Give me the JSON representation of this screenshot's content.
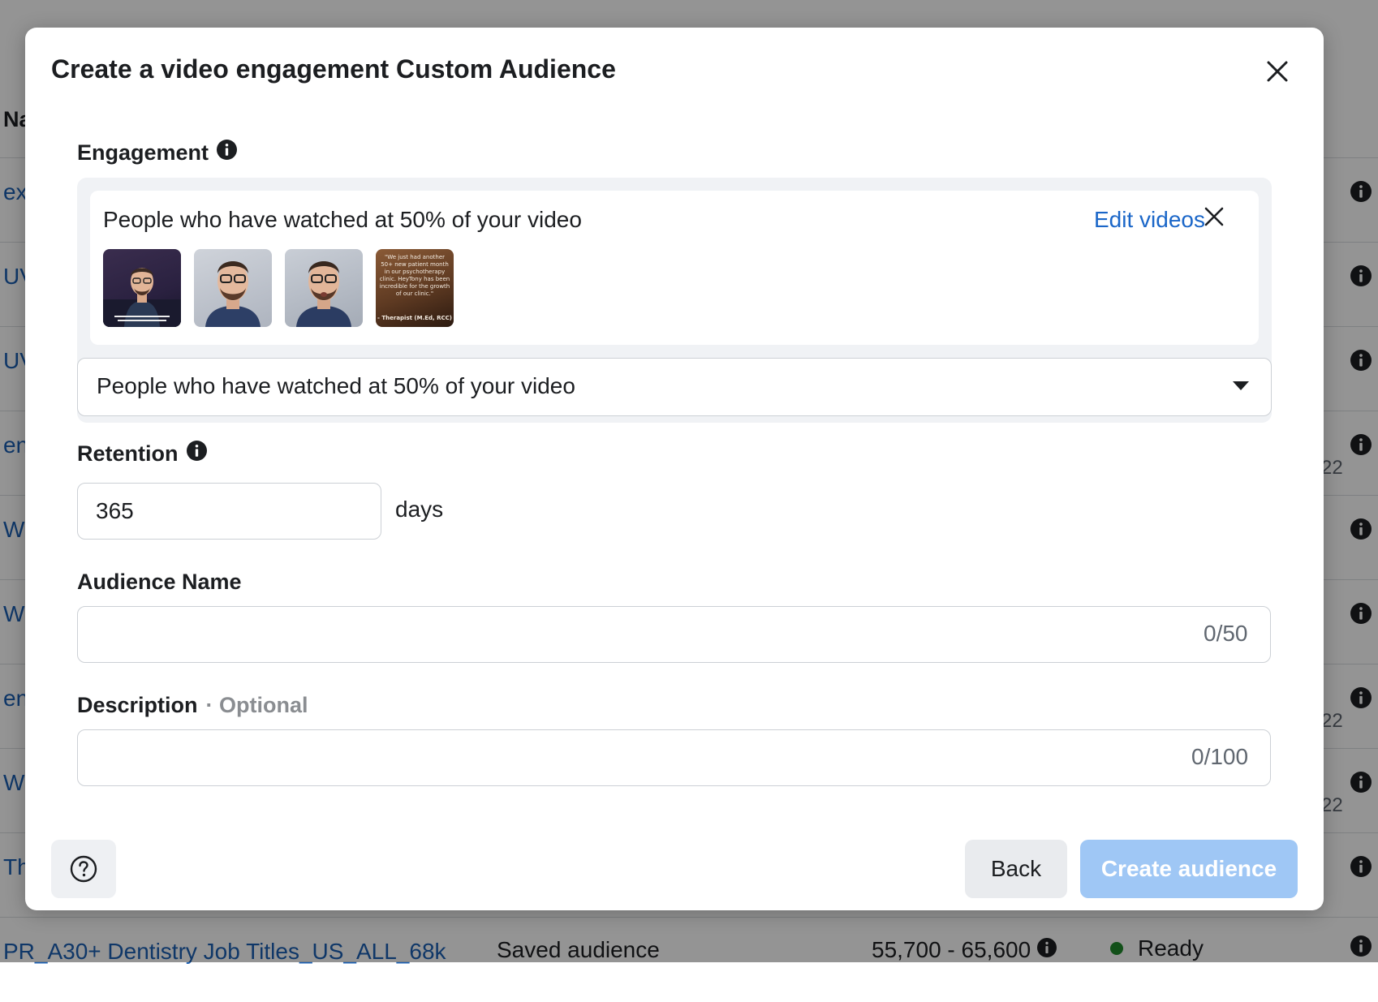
{
  "background": {
    "column_header": "Na",
    "rows": [
      {
        "name": "ex",
        "type": "",
        "size": "",
        "status": "",
        "date": ""
      },
      {
        "name": "UV",
        "type": "",
        "size": "",
        "status": "",
        "date": ""
      },
      {
        "name": "UV",
        "type": "",
        "size": "",
        "status": "",
        "date": ""
      },
      {
        "name": "en",
        "type": "",
        "size": "",
        "status": "",
        "date": "22"
      },
      {
        "name": "Wi",
        "type": "",
        "size": "",
        "status": "",
        "date": ""
      },
      {
        "name": "Wi",
        "type": "",
        "size": "",
        "status": "",
        "date": ""
      },
      {
        "name": "en",
        "type": "",
        "size": "",
        "status": "",
        "date": "22"
      },
      {
        "name": "Wi",
        "type": "",
        "size": "",
        "status": "",
        "date": "22"
      },
      {
        "name": "Th",
        "type": "",
        "size": "",
        "status": "",
        "date": ""
      },
      {
        "name": "PR_A30+ Dentistry Job Titles_US_ALL_68k",
        "type": "Saved audience",
        "size": "55,700 - 65,600",
        "status": "Ready",
        "date": ""
      }
    ]
  },
  "modal": {
    "title": "Create a video engagement Custom Audience",
    "engagement": {
      "label": "Engagement",
      "card_text": "People who have watched at 50% of your video",
      "edit_link": "Edit videos",
      "thumbnail4": {
        "quote": "\"We just had another 50+ new patient month in our psychotherapy clinic. HeyTony has been incredible for the growth of our clinic.\"",
        "signature": "- Therapist (M.Ed, RCC)"
      },
      "dropdown_value": "People who have watched at 50% of your video"
    },
    "retention": {
      "label": "Retention",
      "value": "365",
      "unit": "days"
    },
    "audience_name": {
      "label": "Audience Name",
      "value": "",
      "counter": "0/50"
    },
    "description": {
      "label": "Description",
      "optional": "· Optional",
      "value": "",
      "counter": "0/100"
    },
    "footer": {
      "back_label": "Back",
      "create_label": "Create audience"
    }
  }
}
